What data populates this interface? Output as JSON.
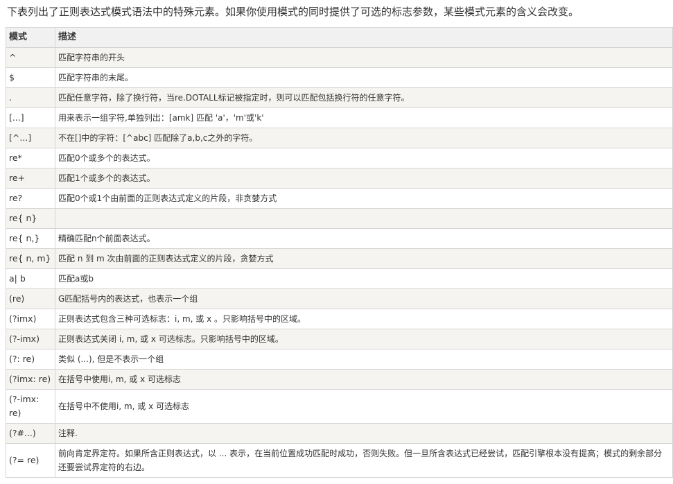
{
  "intro": "下表列出了正则表达式模式语法中的特殊元素。如果你使用模式的同时提供了可选的标志参数，某些模式元素的含义会改变。",
  "table": {
    "headers": [
      "模式",
      "描述"
    ],
    "rows": [
      {
        "pattern": "^",
        "desc": "匹配字符串的开头"
      },
      {
        "pattern": "$",
        "desc": "匹配字符串的末尾。"
      },
      {
        "pattern": ".",
        "desc": "匹配任意字符，除了换行符，当re.DOTALL标记被指定时，则可以匹配包括换行符的任意字符。"
      },
      {
        "pattern": "[...]",
        "desc": "用来表示一组字符,单独列出：[amk] 匹配 'a'，'m'或'k'"
      },
      {
        "pattern": "[^...]",
        "desc": "不在[]中的字符：[^abc] 匹配除了a,b,c之外的字符。"
      },
      {
        "pattern": "re*",
        "desc": "匹配0个或多个的表达式。"
      },
      {
        "pattern": "re+",
        "desc": "匹配1个或多个的表达式。"
      },
      {
        "pattern": "re?",
        "desc": "匹配0个或1个由前面的正则表达式定义的片段，非贪婪方式"
      },
      {
        "pattern": "re{ n}",
        "desc": ""
      },
      {
        "pattern": "re{ n,}",
        "desc": "精确匹配n个前面表达式。"
      },
      {
        "pattern": "re{ n, m}",
        "desc": "匹配 n 到 m 次由前面的正则表达式定义的片段，贪婪方式"
      },
      {
        "pattern": "a| b",
        "desc": "匹配a或b"
      },
      {
        "pattern": "(re)",
        "desc": "G匹配括号内的表达式，也表示一个组"
      },
      {
        "pattern": "(?imx)",
        "desc": "正则表达式包含三种可选标志：i, m, 或 x 。只影响括号中的区域。"
      },
      {
        "pattern": "(?-imx)",
        "desc": "正则表达式关闭 i, m, 或 x 可选标志。只影响括号中的区域。"
      },
      {
        "pattern": "(?: re)",
        "desc": "类似 (...), 但是不表示一个组"
      },
      {
        "pattern": "(?imx: re)",
        "desc": "在括号中使用i, m, 或 x 可选标志"
      },
      {
        "pattern": "(?-imx: re)",
        "desc": "在括号中不使用i, m, 或 x 可选标志"
      },
      {
        "pattern": "(?#...)",
        "desc": "注释."
      },
      {
        "pattern": "(?= re)",
        "desc": "前向肯定界定符。如果所含正则表达式，以 ... 表示，在当前位置成功匹配时成功，否则失败。但一旦所含表达式已经尝试，匹配引擎根本没有提高；模式的剩余部分还要尝试界定符的右边。"
      }
    ]
  },
  "colors": {
    "border": "#d4d4d4",
    "header_bg": "#f1f1f1",
    "row_alt_bg": "#f6f4f0",
    "text": "#333333"
  }
}
